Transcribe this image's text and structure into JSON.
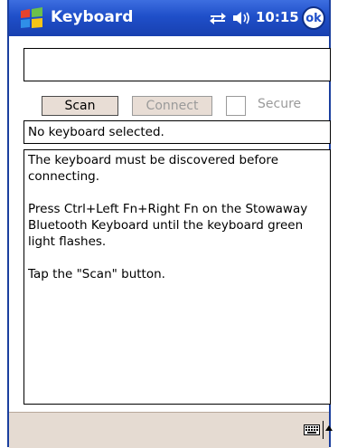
{
  "titlebar": {
    "title": "Keyboard",
    "clock": "10:15",
    "ok_label": "ok"
  },
  "toolbar": {
    "scan_label": "Scan",
    "connect_label": "Connect",
    "secure_label": "Secure"
  },
  "status": {
    "text": "No keyboard selected."
  },
  "info": {
    "paragraphs": [
      "The keyboard must be discovered before connecting.",
      "Press Ctrl+Left Fn+Right Fn on the Stowaway Bluetooth Keyboard until the keyboard green light flashes.",
      "Tap the \"Scan\" button."
    ]
  },
  "icons": {
    "start": "windows-flag-icon",
    "connectivity": "connectivity-icon",
    "volume": "volume-icon",
    "keyboard": "keyboard-icon",
    "sip_arrow": "arrow-up-icon"
  },
  "colors": {
    "titlebar": "#1f4fc9",
    "bottombar": "#e5dbd2",
    "button": "#e8ddd5",
    "disabled_text": "#9a9a9a"
  }
}
